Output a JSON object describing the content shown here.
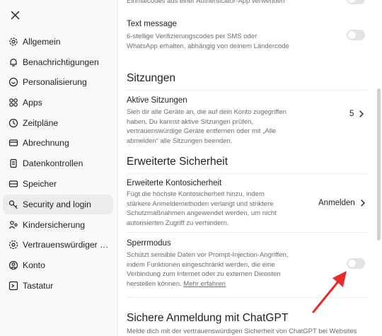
{
  "sidebar": {
    "items": [
      {
        "label": "Allgemein",
        "icon": "gear-icon",
        "active": false
      },
      {
        "label": "Benachrichtigungen",
        "icon": "bell-icon",
        "active": false
      },
      {
        "label": "Personalisierung",
        "icon": "personalization-icon",
        "active": false
      },
      {
        "label": "Apps",
        "icon": "apps-grid-icon",
        "active": false
      },
      {
        "label": "Zeitpläne",
        "icon": "clock-icon",
        "active": false
      },
      {
        "label": "Abrechnung",
        "icon": "credit-card-icon",
        "active": false
      },
      {
        "label": "Datenkontrollen",
        "icon": "data-controls-icon",
        "active": false
      },
      {
        "label": "Speicher",
        "icon": "storage-icon",
        "active": false
      },
      {
        "label": "Security and login",
        "icon": "key-icon",
        "active": true
      },
      {
        "label": "Kindersicherung",
        "icon": "parental-control-icon",
        "active": false
      },
      {
        "label": "Vertrauenswürdiger Kontakt",
        "icon": "trusted-contact-icon",
        "active": false
      },
      {
        "label": "Konto",
        "icon": "account-icon",
        "active": false
      },
      {
        "label": "Tastatur",
        "icon": "keyboard-icon",
        "active": false
      }
    ]
  },
  "content": {
    "auth_app_desc_tail": "Einmalcodes aus einer Authenticator-App verwenden",
    "text_message": {
      "title": "Text message",
      "desc": "6-stellige Verifizierungscodes per SMS oder WhatsApp erhalten, abhängig von deinem Ländercode",
      "enabled": false
    },
    "sessions": {
      "heading": "Sitzungen",
      "title": "Aktive Sitzungen",
      "desc": "Sieh dir alle Geräte an, die auf dein Konto zugegriffen haben. Du kannst aktive Sitzungen prüfen, vertrauenswürdige Geräte entfernen oder mit „Alle abmelden“ alle Sitzungen beenden.",
      "count": "5"
    },
    "advanced": {
      "heading": "Erweiterte Sicherheit",
      "title": "Erweiterte Kontosicherheit",
      "desc": "Fügt die höchste Kontosicherheit hinzu, indem stärkere Anmeldemethoden verlangt und striktere Schutzmaßnahmen angewendet werden, um nicht autorisierten Zugriff zu verhindern.",
      "action": "Anmelden"
    },
    "lockdown": {
      "title": "Sperrmodus",
      "desc": "Schützt sensible Daten vor Prompt-Injection-Angriffen, indem Funktionen eingeschränkt werden, die eine Verbindung zum Internet oder zu externen Diensten herstellen können.",
      "link": "Mehr erfahren",
      "enabled": false
    },
    "chatgpt_login": {
      "heading": "Sichere Anmeldung mit ChatGPT",
      "desc": "Melde dich mit der vertrauenswürdigen Sicherheit von ChatGPT bei Websites"
    }
  },
  "colors": {
    "annotation_arrow": "#e52b2b",
    "toggle_off": "#e3e3e3",
    "active_nav_bg": "#ececec"
  }
}
